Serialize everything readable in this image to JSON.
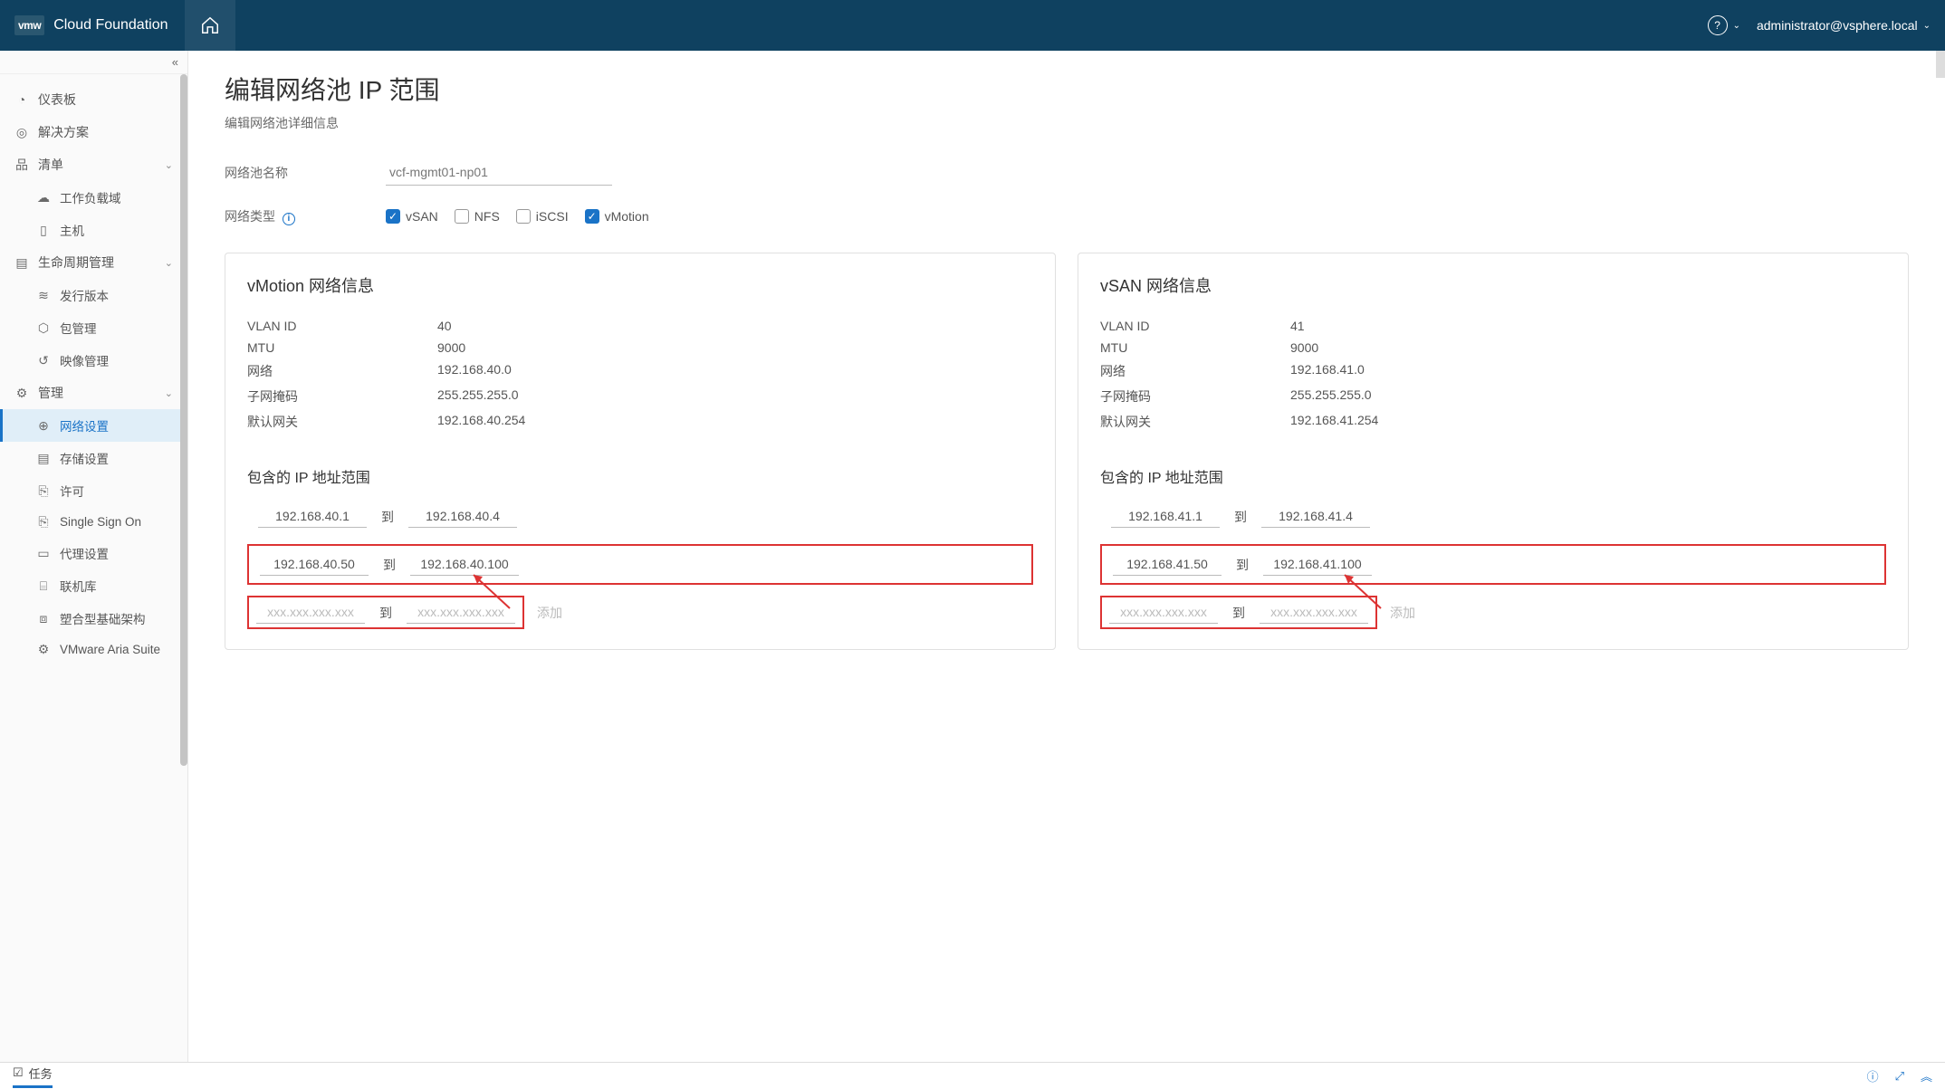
{
  "header": {
    "brand_logo": "vmw",
    "brand_text": "Cloud Foundation",
    "user": "administrator@vsphere.local"
  },
  "sidebar": {
    "items": [
      {
        "label": "仪表板",
        "icon": "◔",
        "lvl": 1
      },
      {
        "label": "解决方案",
        "icon": "◎",
        "lvl": 1
      },
      {
        "label": "清单",
        "icon": "品",
        "lvl": 1,
        "chev": "⌄"
      },
      {
        "label": "工作负载域",
        "icon": "☁",
        "lvl": 2
      },
      {
        "label": "主机",
        "icon": "▯",
        "lvl": 2
      },
      {
        "label": "生命周期管理",
        "icon": "▤",
        "lvl": 1,
        "chev": "⌄"
      },
      {
        "label": "发行版本",
        "icon": "≋",
        "lvl": 2
      },
      {
        "label": "包管理",
        "icon": "⬡",
        "lvl": 2
      },
      {
        "label": "映像管理",
        "icon": "↺",
        "lvl": 2
      },
      {
        "label": "管理",
        "icon": "⚙",
        "lvl": 1,
        "chev": "⌄"
      },
      {
        "label": "网络设置",
        "icon": "⊕",
        "lvl": 2,
        "active": true
      },
      {
        "label": "存储设置",
        "icon": "▤",
        "lvl": 2
      },
      {
        "label": "许可",
        "icon": "⎘",
        "lvl": 2
      },
      {
        "label": "Single Sign On",
        "icon": "⎘",
        "lvl": 2
      },
      {
        "label": "代理设置",
        "icon": "▭",
        "lvl": 2
      },
      {
        "label": "联机库",
        "icon": "⌸",
        "lvl": 2
      },
      {
        "label": "塑合型基础架构",
        "icon": "⧈",
        "lvl": 2
      },
      {
        "label": "VMware Aria Suite",
        "icon": "⚙",
        "lvl": 2
      }
    ]
  },
  "page": {
    "title": "编辑网络池 IP 范围",
    "subtitle": "编辑网络池详细信息",
    "name_label": "网络池名称",
    "name_value": "vcf-mgmt01-np01",
    "type_label": "网络类型",
    "types": {
      "vsan": {
        "label": "vSAN",
        "checked": true
      },
      "nfs": {
        "label": "NFS",
        "checked": false
      },
      "iscsi": {
        "label": "iSCSI",
        "checked": false
      },
      "vmotion": {
        "label": "vMotion",
        "checked": true
      }
    }
  },
  "panels": {
    "vmotion": {
      "title": "vMotion 网络信息",
      "rows": {
        "vlan": {
          "k": "VLAN ID",
          "v": "40"
        },
        "mtu": {
          "k": "MTU",
          "v": "9000"
        },
        "net": {
          "k": "网络",
          "v": "192.168.40.0"
        },
        "mask": {
          "k": "子网掩码",
          "v": "255.255.255.0"
        },
        "gw": {
          "k": "默认网关",
          "v": "192.168.40.254"
        }
      },
      "range_title": "包含的 IP 地址范围",
      "to_label": "到",
      "ranges": [
        {
          "from": "192.168.40.1",
          "to": "192.168.40.4"
        },
        {
          "from": "192.168.40.50",
          "to": "192.168.40.100"
        }
      ],
      "placeholder": "xxx.xxx.xxx.xxx",
      "add_label": "添加"
    },
    "vsan": {
      "title": "vSAN 网络信息",
      "rows": {
        "vlan": {
          "k": "VLAN ID",
          "v": "41"
        },
        "mtu": {
          "k": "MTU",
          "v": "9000"
        },
        "net": {
          "k": "网络",
          "v": "192.168.41.0"
        },
        "mask": {
          "k": "子网掩码",
          "v": "255.255.255.0"
        },
        "gw": {
          "k": "默认网关",
          "v": "192.168.41.254"
        }
      },
      "range_title": "包含的 IP 地址范围",
      "to_label": "到",
      "ranges": [
        {
          "from": "192.168.41.1",
          "to": "192.168.41.4"
        },
        {
          "from": "192.168.41.50",
          "to": "192.168.41.100"
        }
      ],
      "placeholder": "xxx.xxx.xxx.xxx",
      "add_label": "添加"
    }
  },
  "tasks": {
    "label": "任务"
  }
}
